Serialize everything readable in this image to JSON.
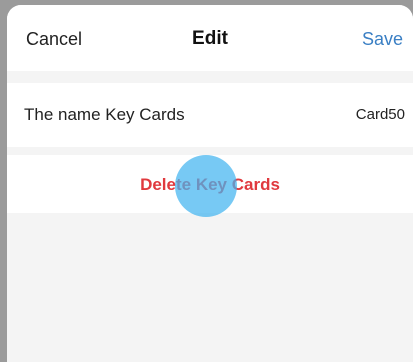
{
  "header": {
    "cancel_label": "Cancel",
    "title": "Edit",
    "save_label": "Save"
  },
  "name_row": {
    "label": "The name Key Cards",
    "value": "Card50"
  },
  "delete_row": {
    "label": "Delete Key Cards"
  },
  "colors": {
    "save_accent": "#3a7fc4",
    "delete_red": "#e0393e",
    "touch_indicator": "#42b4f0"
  }
}
